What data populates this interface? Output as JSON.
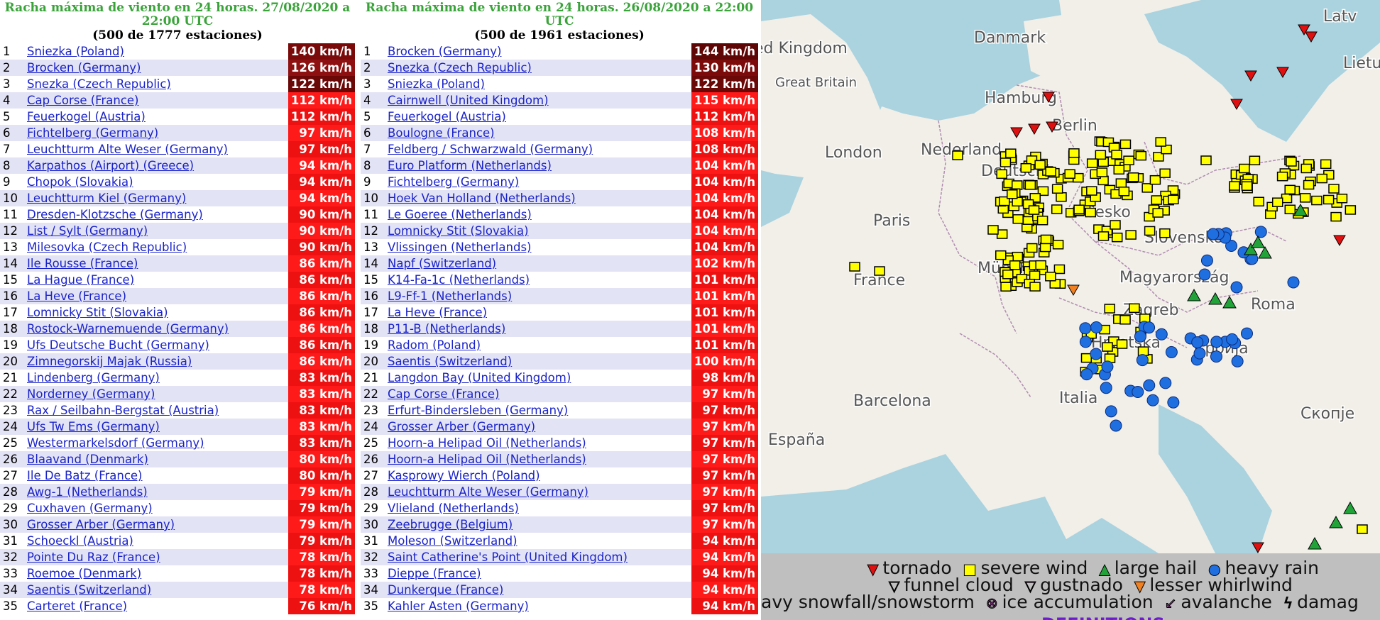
{
  "panel1": {
    "title": "Racha máxima de viento en 24 horas. 27/08/2020 a 22:00 UTC",
    "subtitle": "(500 de 1777 estaciones)",
    "rows": [
      {
        "rank": "1",
        "station": "Sniezka (Poland)",
        "wind": "140 km/h"
      },
      {
        "rank": "2",
        "station": "Brocken (Germany)",
        "wind": "126 km/h"
      },
      {
        "rank": "3",
        "station": "Snezka (Czech Republic)",
        "wind": "122 km/h"
      },
      {
        "rank": "4",
        "station": "Cap Corse (France)",
        "wind": "112 km/h"
      },
      {
        "rank": "5",
        "station": "Feuerkogel (Austria)",
        "wind": "112 km/h"
      },
      {
        "rank": "6",
        "station": "Fichtelberg (Germany)",
        "wind": "97 km/h"
      },
      {
        "rank": "7",
        "station": "Leuchtturm Alte Weser (Germany)",
        "wind": "97 km/h"
      },
      {
        "rank": "8",
        "station": "Karpathos (Airport) (Greece)",
        "wind": "94 km/h"
      },
      {
        "rank": "9",
        "station": "Chopok (Slovakia)",
        "wind": "94 km/h"
      },
      {
        "rank": "10",
        "station": "Leuchtturm Kiel (Germany)",
        "wind": "94 km/h"
      },
      {
        "rank": "11",
        "station": "Dresden-Klotzsche (Germany)",
        "wind": "90 km/h"
      },
      {
        "rank": "12",
        "station": "List / Sylt (Germany)",
        "wind": "90 km/h"
      },
      {
        "rank": "13",
        "station": "Milesovka (Czech Republic)",
        "wind": "90 km/h"
      },
      {
        "rank": "14",
        "station": "Ile Rousse (France)",
        "wind": "86 km/h"
      },
      {
        "rank": "15",
        "station": "La Hague (France)",
        "wind": "86 km/h"
      },
      {
        "rank": "16",
        "station": "La Heve (France)",
        "wind": "86 km/h"
      },
      {
        "rank": "17",
        "station": "Lomnicky Stit (Slovakia)",
        "wind": "86 km/h"
      },
      {
        "rank": "18",
        "station": "Rostock-Warnemuende (Germany)",
        "wind": "86 km/h"
      },
      {
        "rank": "19",
        "station": "Ufs Deutsche Bucht (Germany)",
        "wind": "86 km/h"
      },
      {
        "rank": "20",
        "station": "Zimnegorskij Majak (Russia)",
        "wind": "86 km/h"
      },
      {
        "rank": "21",
        "station": "Lindenberg (Germany)",
        "wind": "83 km/h"
      },
      {
        "rank": "22",
        "station": "Norderney (Germany)",
        "wind": "83 km/h"
      },
      {
        "rank": "23",
        "station": "Rax / Seilbahn-Bergstat (Austria)",
        "wind": "83 km/h"
      },
      {
        "rank": "24",
        "station": "Ufs Tw Ems (Germany)",
        "wind": "83 km/h"
      },
      {
        "rank": "25",
        "station": "Westermarkelsdorf (Germany)",
        "wind": "83 km/h"
      },
      {
        "rank": "26",
        "station": "Blaavand (Denmark)",
        "wind": "80 km/h"
      },
      {
        "rank": "27",
        "station": "Ile De Batz (France)",
        "wind": "80 km/h"
      },
      {
        "rank": "28",
        "station": "Awg-1 (Netherlands)",
        "wind": "79 km/h"
      },
      {
        "rank": "29",
        "station": "Cuxhaven (Germany)",
        "wind": "79 km/h"
      },
      {
        "rank": "30",
        "station": "Grosser Arber (Germany)",
        "wind": "79 km/h"
      },
      {
        "rank": "31",
        "station": "Schoeckl (Austria)",
        "wind": "79 km/h"
      },
      {
        "rank": "32",
        "station": "Pointe Du Raz (France)",
        "wind": "78 km/h"
      },
      {
        "rank": "33",
        "station": "Roemoe (Denmark)",
        "wind": "78 km/h"
      },
      {
        "rank": "34",
        "station": "Saentis (Switzerland)",
        "wind": "78 km/h"
      },
      {
        "rank": "35",
        "station": "Carteret (France)",
        "wind": "76 km/h"
      }
    ]
  },
  "panel2": {
    "title": "Racha máxima de viento en 24 horas. 26/08/2020 a 22:00 UTC",
    "subtitle": "(500 de 1961 estaciones)",
    "rows": [
      {
        "rank": "1",
        "station": "Brocken (Germany)",
        "wind": "144 km/h"
      },
      {
        "rank": "2",
        "station": "Snezka (Czech Republic)",
        "wind": "130 km/h"
      },
      {
        "rank": "3",
        "station": "Sniezka (Poland)",
        "wind": "122 km/h"
      },
      {
        "rank": "4",
        "station": "Cairnwell (United Kingdom)",
        "wind": "115 km/h"
      },
      {
        "rank": "5",
        "station": "Feuerkogel (Austria)",
        "wind": "112 km/h"
      },
      {
        "rank": "6",
        "station": "Boulogne (France)",
        "wind": "108 km/h"
      },
      {
        "rank": "7",
        "station": "Feldberg / Schwarzwald (Germany)",
        "wind": "108 km/h"
      },
      {
        "rank": "8",
        "station": "Euro Platform (Netherlands)",
        "wind": "104 km/h"
      },
      {
        "rank": "9",
        "station": "Fichtelberg (Germany)",
        "wind": "104 km/h"
      },
      {
        "rank": "10",
        "station": "Hoek Van Holland (Netherlands)",
        "wind": "104 km/h"
      },
      {
        "rank": "11",
        "station": "Le Goeree (Netherlands)",
        "wind": "104 km/h"
      },
      {
        "rank": "12",
        "station": "Lomnicky Stit (Slovakia)",
        "wind": "104 km/h"
      },
      {
        "rank": "13",
        "station": "Vlissingen (Netherlands)",
        "wind": "104 km/h"
      },
      {
        "rank": "14",
        "station": "Napf (Switzerland)",
        "wind": "102 km/h"
      },
      {
        "rank": "15",
        "station": "K14-Fa-1c (Netherlands)",
        "wind": "101 km/h"
      },
      {
        "rank": "16",
        "station": "L9-Ff-1 (Netherlands)",
        "wind": "101 km/h"
      },
      {
        "rank": "17",
        "station": "La Heve (France)",
        "wind": "101 km/h"
      },
      {
        "rank": "18",
        "station": "P11-B (Netherlands)",
        "wind": "101 km/h"
      },
      {
        "rank": "19",
        "station": "Radom (Poland)",
        "wind": "101 km/h"
      },
      {
        "rank": "20",
        "station": "Saentis (Switzerland)",
        "wind": "100 km/h"
      },
      {
        "rank": "21",
        "station": "Langdon Bay (United Kingdom)",
        "wind": "98 km/h"
      },
      {
        "rank": "22",
        "station": "Cap Corse (France)",
        "wind": "97 km/h"
      },
      {
        "rank": "23",
        "station": "Erfurt-Bindersleben (Germany)",
        "wind": "97 km/h"
      },
      {
        "rank": "24",
        "station": "Grosser Arber (Germany)",
        "wind": "97 km/h"
      },
      {
        "rank": "25",
        "station": "Hoorn-a Helipad Oil (Netherlands)",
        "wind": "97 km/h"
      },
      {
        "rank": "26",
        "station": "Hoorn-a Helipad Oil (Netherlands)",
        "wind": "97 km/h"
      },
      {
        "rank": "27",
        "station": "Kasprowy Wierch (Poland)",
        "wind": "97 km/h"
      },
      {
        "rank": "28",
        "station": "Leuchtturm Alte Weser (Germany)",
        "wind": "97 km/h"
      },
      {
        "rank": "29",
        "station": "Vlieland (Netherlands)",
        "wind": "97 km/h"
      },
      {
        "rank": "30",
        "station": "Zeebrugge (Belgium)",
        "wind": "97 km/h"
      },
      {
        "rank": "31",
        "station": "Moleson (Switzerland)",
        "wind": "94 km/h"
      },
      {
        "rank": "32",
        "station": "Saint Catherine's Point (United Kingdom)",
        "wind": "94 km/h"
      },
      {
        "rank": "33",
        "station": "Dieppe (France)",
        "wind": "94 km/h"
      },
      {
        "rank": "34",
        "station": "Dunkerque (France)",
        "wind": "94 km/h"
      },
      {
        "rank": "35",
        "station": "Kahler Asten (Germany)",
        "wind": "94 km/h"
      }
    ]
  },
  "map": {
    "labels": [
      "Danmark",
      "ed Kingdom",
      "Great Britain",
      "Hamburg",
      "Berlin",
      "London",
      "Nederland",
      "Deutschl",
      "Paris",
      "France",
      "Česko",
      "Slovensko",
      "München",
      "Magyarország",
      "Zagreb",
      "Hrvatska",
      "Србија",
      "Roma",
      "Barcelona",
      "Italia",
      "España",
      "Скопје",
      "Latv",
      "Lietu"
    ],
    "colors": {
      "sea": "#aad3df",
      "land": "#f2efe9",
      "severe_wind": "#ffff00",
      "heavy_rain": "#1f6fe0",
      "large_hail": "#22a33a",
      "tornado": "#e01010",
      "lesser_whirlwind": "#f08020"
    }
  },
  "legend": {
    "row1": [
      {
        "icon": "tornado-icon",
        "symbol": "▼",
        "color": "#e01010",
        "label": "tornado"
      },
      {
        "icon": "severe-wind-icon",
        "symbol": "■",
        "color": "#ffff00",
        "label": "severe wind"
      },
      {
        "icon": "large-hail-icon",
        "symbol": "▲",
        "color": "#22a33a",
        "label": "large hail"
      },
      {
        "icon": "heavy-rain-icon",
        "symbol": "●",
        "color": "#1f6fe0",
        "label": "heavy rain"
      }
    ],
    "row2": [
      {
        "icon": "funnel-cloud-icon",
        "symbol": "▽",
        "color": "#ffffff",
        "label": "funnel cloud"
      },
      {
        "icon": "gustnado-icon",
        "symbol": "▽",
        "color": "#e070e0",
        "label": "gustnado"
      },
      {
        "icon": "lesser-whirlwind-icon",
        "symbol": "▼",
        "color": "#f08020",
        "label": "lesser whirlwind"
      }
    ],
    "row3": [
      {
        "icon": "",
        "symbol": "",
        "color": "",
        "label": "avy snowfall/snowstorm"
      },
      {
        "icon": "ice-accumulation-icon",
        "symbol": "⊗",
        "color": "#b040b0",
        "label": "ice accumulation"
      },
      {
        "icon": "avalanche-icon",
        "symbol": "↙",
        "color": "#b040b0",
        "label": "avalanche"
      },
      {
        "icon": "damage-icon",
        "symbol": "ϟ",
        "color": "#111111",
        "label": "damag"
      }
    ],
    "definitions": "DEFINITIONS"
  }
}
